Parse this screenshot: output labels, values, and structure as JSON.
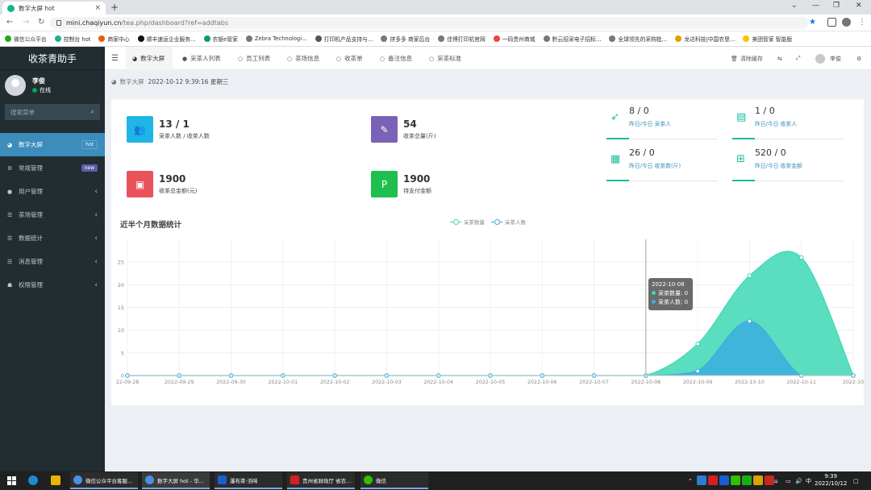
{
  "browser": {
    "tab_title": "数字大屏 hot",
    "url_host": "mini.chaqiyun.cn",
    "url_path": "/tea.php/dashboard?ref=addtabs",
    "bookmarks": [
      "微信公众平台",
      "控制台 hot",
      "商家中心",
      "顺丰速运企业服务...",
      "农银e管家",
      "Zebra Technologi...",
      "打印机产品支持与...",
      "拼多多 商家后台",
      "佳博打印机官网",
      "一码贵州商城",
      "黔云招采电子招标...",
      "全球领先的采购批...",
      "龙达科技|中国农垦...",
      "美团管家 智能版"
    ]
  },
  "sidebar": {
    "app_title": "收茶青助手",
    "user_name": "李俊",
    "user_status": "在线",
    "search_placeholder": "搜索菜单",
    "menu": [
      {
        "label": "数字大屏",
        "badge": "hot",
        "badge_color": "#3c8dbc",
        "icon": "dashboard-icon"
      },
      {
        "label": "常规管理",
        "badge": "new",
        "badge_color": "#605ca8",
        "icon": "cogs-icon"
      },
      {
        "label": "用户管理",
        "icon": "user-icon"
      },
      {
        "label": "茶场管理",
        "icon": "list-icon"
      },
      {
        "label": "数据统计",
        "icon": "list-icon"
      },
      {
        "label": "消息管理",
        "icon": "list-icon"
      },
      {
        "label": "权限管理",
        "icon": "group-icon"
      }
    ]
  },
  "topnav": {
    "tabs": [
      "数字大屏",
      "采茶人列表",
      "员工列表",
      "茶场信息",
      "收茶单",
      "备注信息",
      "采茶标准"
    ],
    "clear_cache": "清除缓存",
    "user_name": "李俊"
  },
  "breadcrumb": {
    "text": "数字大屏",
    "datetime": "2022-10-12 9:39:16 星期三"
  },
  "stats": [
    {
      "value": "13 / 1",
      "label": "采茶人数 / 收茶人数",
      "color": "#1fb5e6",
      "icon": "users-icon"
    },
    {
      "value": "54",
      "label": "收茶总量(斤)",
      "color": "#7a62b6",
      "icon": "magic-icon"
    },
    {
      "value": "1900",
      "label": "收茶总金额(元)",
      "color": "#e8525a",
      "icon": "money-icon"
    },
    {
      "value": "1900",
      "label": "待支付金额",
      "color": "#1fbf4f",
      "icon": "paypal-icon"
    }
  ],
  "mini_stats": [
    {
      "value": "8 / 0",
      "label": "昨日/今日 采茶人",
      "icon": "rocket-icon"
    },
    {
      "value": "1 / 0",
      "label": "昨日/今日 收茶人",
      "icon": "idcard-icon"
    },
    {
      "value": "26 / 0",
      "label": "昨日/今日 收茶数(斤)",
      "icon": "calendar-icon"
    },
    {
      "value": "520 / 0",
      "label": "昨日/今日 收茶金额",
      "icon": "calendar-plus-icon"
    }
  ],
  "chart_data": {
    "type": "area",
    "title": "近半个月数据统计",
    "x": [
      "2022-09-28",
      "2022-09-29",
      "2022-09-30",
      "2022-10-01",
      "2022-10-02",
      "2022-10-03",
      "2022-10-04",
      "2022-10-05",
      "2022-10-06",
      "2022-10-07",
      "2022-10-08",
      "2022-10-09",
      "2022-10-10",
      "2022-10-11",
      "2022-10-12"
    ],
    "x_tick_labels": [
      "22-09-28",
      "2022-09-29",
      "2022-09-30",
      "2022-10-01",
      "2022-10-02",
      "2022-10-03",
      "2022-10-04",
      "2022-10-05",
      "2022-10-06",
      "2022-10-07",
      "2022-10-08",
      "2022-10-09",
      "2022-10-10",
      "2022-10-11",
      "2022-10"
    ],
    "series": [
      {
        "name": "采茶数量",
        "values": [
          0,
          0,
          0,
          0,
          0,
          0,
          0,
          0,
          0,
          0,
          0,
          7,
          22,
          26,
          0
        ],
        "color": "#3ed7b5"
      },
      {
        "name": "采茶人数",
        "values": [
          0,
          0,
          0,
          0,
          0,
          0,
          0,
          0,
          0,
          0,
          0,
          1,
          12,
          0,
          0
        ],
        "color": "#3caee0"
      }
    ],
    "ylim": [
      0,
      30
    ],
    "yticks": [
      0,
      5,
      10,
      15,
      20,
      25
    ],
    "grid": true,
    "legend": "top-center",
    "tooltip": {
      "date": "2022-10-08",
      "line1": "采茶数量: 0",
      "line2": "采茶人数: 0"
    }
  },
  "taskbar": {
    "apps": [
      "微信公众平台客服...",
      "数字大屏 hot - 华...",
      "瀑布茶·滔味",
      "贵州省财政厅 省农...",
      "微信"
    ],
    "time": "9:39",
    "date": "2022/10/12",
    "ime": "中"
  }
}
